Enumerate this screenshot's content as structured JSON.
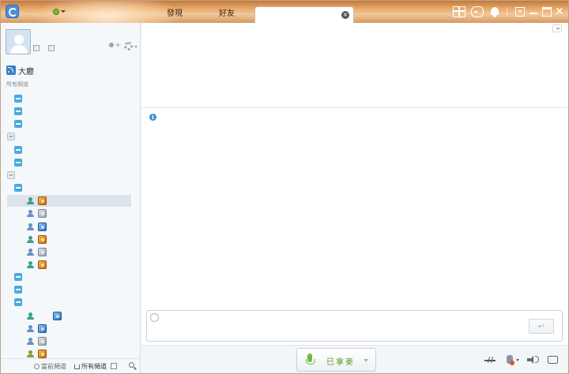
{
  "titlebar": {
    "tabs": [
      {
        "label": "發現"
      },
      {
        "label": "好友"
      },
      {
        "label": ""
      }
    ],
    "close_tab_glyph": "×",
    "icons": [
      "app-logo-icon",
      "status-online-icon",
      "gift-icon",
      "gamepad-icon",
      "bell-icon",
      "menu-icon",
      "minimize-icon",
      "maximize-icon",
      "close-icon"
    ],
    "accent_color": "#d8955a"
  },
  "sidebar": {
    "channel": {
      "title": "大廳",
      "subtitle": "所有頻道"
    },
    "tree": [
      {
        "kind": "group",
        "expanded": true
      },
      {
        "kind": "group",
        "expanded": true
      },
      {
        "kind": "group",
        "expanded": true
      },
      {
        "kind": "group",
        "expanded": false
      },
      {
        "kind": "group",
        "expanded": true
      },
      {
        "kind": "group",
        "expanded": true
      },
      {
        "kind": "group",
        "expanded": false
      },
      {
        "kind": "group",
        "expanded": true
      },
      {
        "kind": "member",
        "user_icon": "teal",
        "badge": "gold",
        "selected": true
      },
      {
        "kind": "member",
        "user_icon": "blue",
        "badge": "grey"
      },
      {
        "kind": "member",
        "user_icon": "blue",
        "badge": "blue"
      },
      {
        "kind": "member",
        "user_icon": "teal",
        "badge": "gold"
      },
      {
        "kind": "member",
        "user_icon": "blue",
        "badge": "grey"
      },
      {
        "kind": "member",
        "user_icon": "teal",
        "badge": "gold"
      },
      {
        "kind": "group",
        "expanded": true
      },
      {
        "kind": "group",
        "expanded": true
      },
      {
        "kind": "group",
        "expanded": true
      },
      {
        "kind": "member",
        "user_icon": "teal",
        "badge": "blue",
        "badge_offset": true
      },
      {
        "kind": "member",
        "user_icon": "blue",
        "badge": "blue"
      },
      {
        "kind": "member",
        "user_icon": "blue",
        "badge": "grey"
      },
      {
        "kind": "member",
        "user_icon": "olive",
        "badge": "gold"
      }
    ],
    "footer": {
      "current_channel": "當前頻道",
      "all_channels": "所有頻道"
    }
  },
  "main": {
    "info_glyph": "i",
    "send_glyph": "↵",
    "speak_label": "已拿麥"
  },
  "colors": {
    "group_toggle": "#4aa9e0",
    "mic_green": "#6cbf3a",
    "selected_row": "#dde3ea"
  }
}
